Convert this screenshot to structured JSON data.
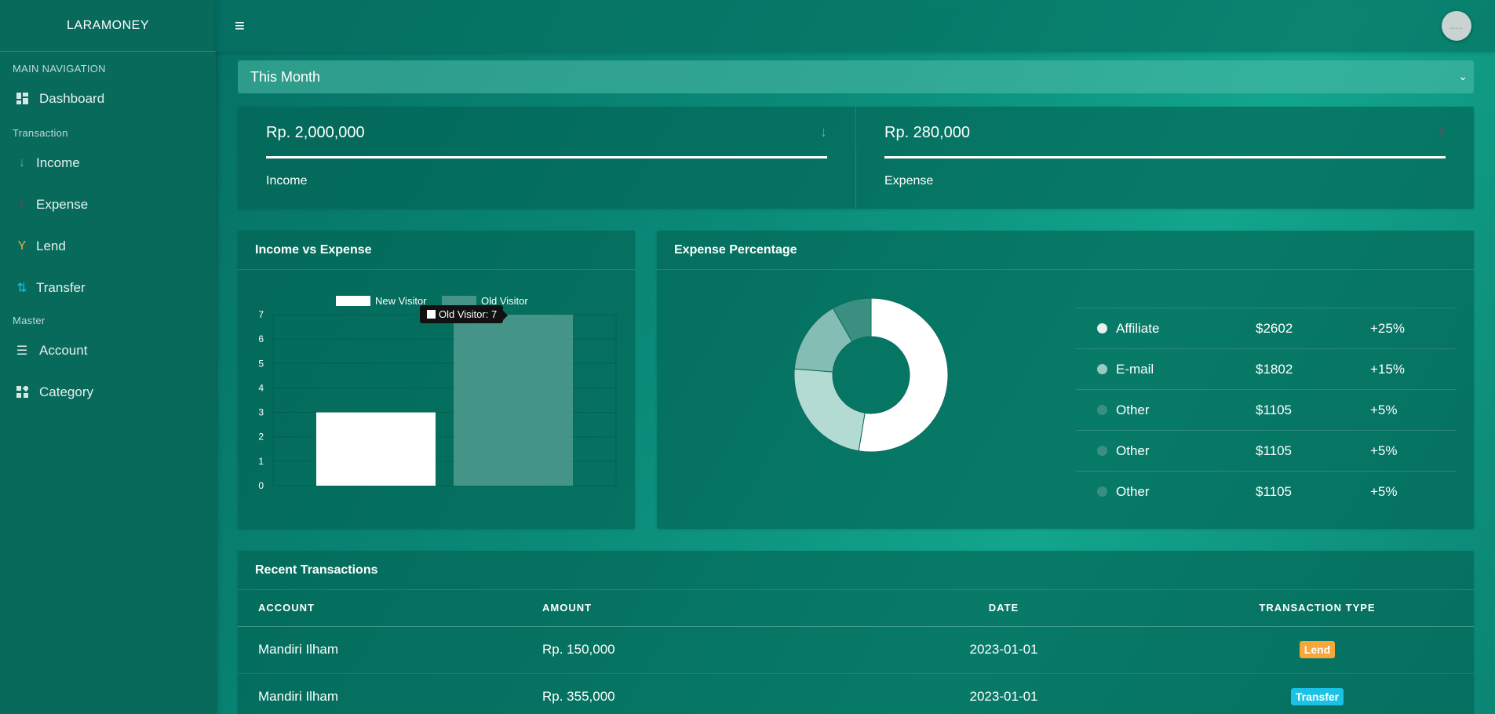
{
  "brand": "LARAMONEY",
  "sidebar": {
    "main_header": "MAIN NAVIGATION",
    "dashboard": "Dashboard",
    "transaction_header": "Transaction",
    "income": "Income",
    "expense": "Expense",
    "lend": "Lend",
    "transfer": "Transfer",
    "master_header": "Master",
    "account": "Account",
    "category": "Category"
  },
  "topbar": {
    "menu_icon": "hamburger-icon",
    "avatar_text": "....."
  },
  "period": {
    "selected": "This Month",
    "icon": "chevron-down-icon"
  },
  "stats": {
    "income": {
      "amount": "Rp. 2,000,000",
      "label": "Income",
      "color": "#2bd66e"
    },
    "expense": {
      "amount": "Rp. 280,000",
      "label": "Expense",
      "color": "#d6194b"
    }
  },
  "income_vs_expense": {
    "title": "Income vs Expense",
    "tooltip": "Old Visitor: 7"
  },
  "expense_percentage": {
    "title": "Expense Percentage",
    "rows": [
      {
        "name": "Affiliate",
        "amount": "$2602",
        "change": "+25%",
        "color": "#ffffff"
      },
      {
        "name": "E-mail",
        "amount": "$1802",
        "change": "+15%",
        "color": "#b4dad4"
      },
      {
        "name": "Other",
        "amount": "$1105",
        "change": "+5%",
        "color": "#83bdb3"
      },
      {
        "name": "Other",
        "amount": "$1105",
        "change": "+5%",
        "color": "#3a8f80"
      },
      {
        "name": "Other",
        "amount": "$1105",
        "change": "+5%",
        "color": "#3a8f80"
      }
    ]
  },
  "chart_data": [
    {
      "type": "bar",
      "title": "Income vs Expense",
      "categories": [
        "New Visitor",
        "Old Visitor"
      ],
      "series": [
        {
          "name": "New Visitor",
          "values": [
            3
          ]
        },
        {
          "name": "Old Visitor",
          "values": [
            7
          ]
        }
      ],
      "ylim": [
        0,
        7
      ],
      "yticks": [
        "0",
        "1",
        "2",
        "3",
        "4",
        "5",
        "6",
        "7"
      ],
      "grid": true,
      "legend": "top"
    },
    {
      "type": "pie",
      "title": "Expense Percentage",
      "labels": [
        "Affiliate",
        "E-mail",
        "Other",
        "Other"
      ],
      "values": [
        51,
        23,
        15,
        8
      ],
      "colors": [
        "#ffffff",
        "#b4dad4",
        "#83bdb3",
        "#3a8f80"
      ]
    }
  ],
  "transactions": {
    "title": "Recent Transactions",
    "columns": [
      "ACCOUNT",
      "AMOUNT",
      "DATE",
      "TRANSACTION TYPE"
    ],
    "rows": [
      {
        "account": "Mandiri Ilham",
        "amount": "Rp. 150,000",
        "date": "2023-01-01",
        "type": "Lend",
        "type_color": "#f7a73a"
      },
      {
        "account": "Mandiri Ilham",
        "amount": "Rp. 355,000",
        "date": "2023-01-01",
        "type": "Transfer",
        "type_color": "#1bc2e6"
      }
    ]
  }
}
